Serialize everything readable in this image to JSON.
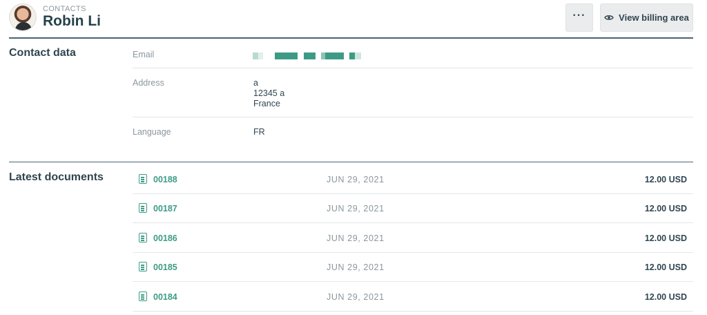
{
  "header": {
    "breadcrumb": "CONTACTS",
    "title": "Robin Li",
    "more_label": "···",
    "billing_label": "View billing area"
  },
  "contact_section": {
    "title": "Contact data",
    "email_label": "Email",
    "address_label": "Address",
    "address_lines": [
      "a",
      "12345 a",
      "France"
    ],
    "language_label": "Language",
    "language_value": "FR"
  },
  "documents_section": {
    "title": "Latest documents",
    "rows": [
      {
        "number": "00188",
        "date": "JUN 29, 2021",
        "amount": "12.00 USD"
      },
      {
        "number": "00187",
        "date": "JUN 29, 2021",
        "amount": "12.00 USD"
      },
      {
        "number": "00186",
        "date": "JUN 29, 2021",
        "amount": "12.00 USD"
      },
      {
        "number": "00185",
        "date": "JUN 29, 2021",
        "amount": "12.00 USD"
      },
      {
        "number": "00184",
        "date": "JUN 29, 2021",
        "amount": "12.00 USD"
      }
    ]
  },
  "colors": {
    "accent": "#3d9b85",
    "text": "#2f4550",
    "muted": "#8a979d",
    "divider": "#e3e6e7"
  },
  "icons": [
    "avatar",
    "more-icon",
    "eye-icon",
    "document-icon"
  ]
}
